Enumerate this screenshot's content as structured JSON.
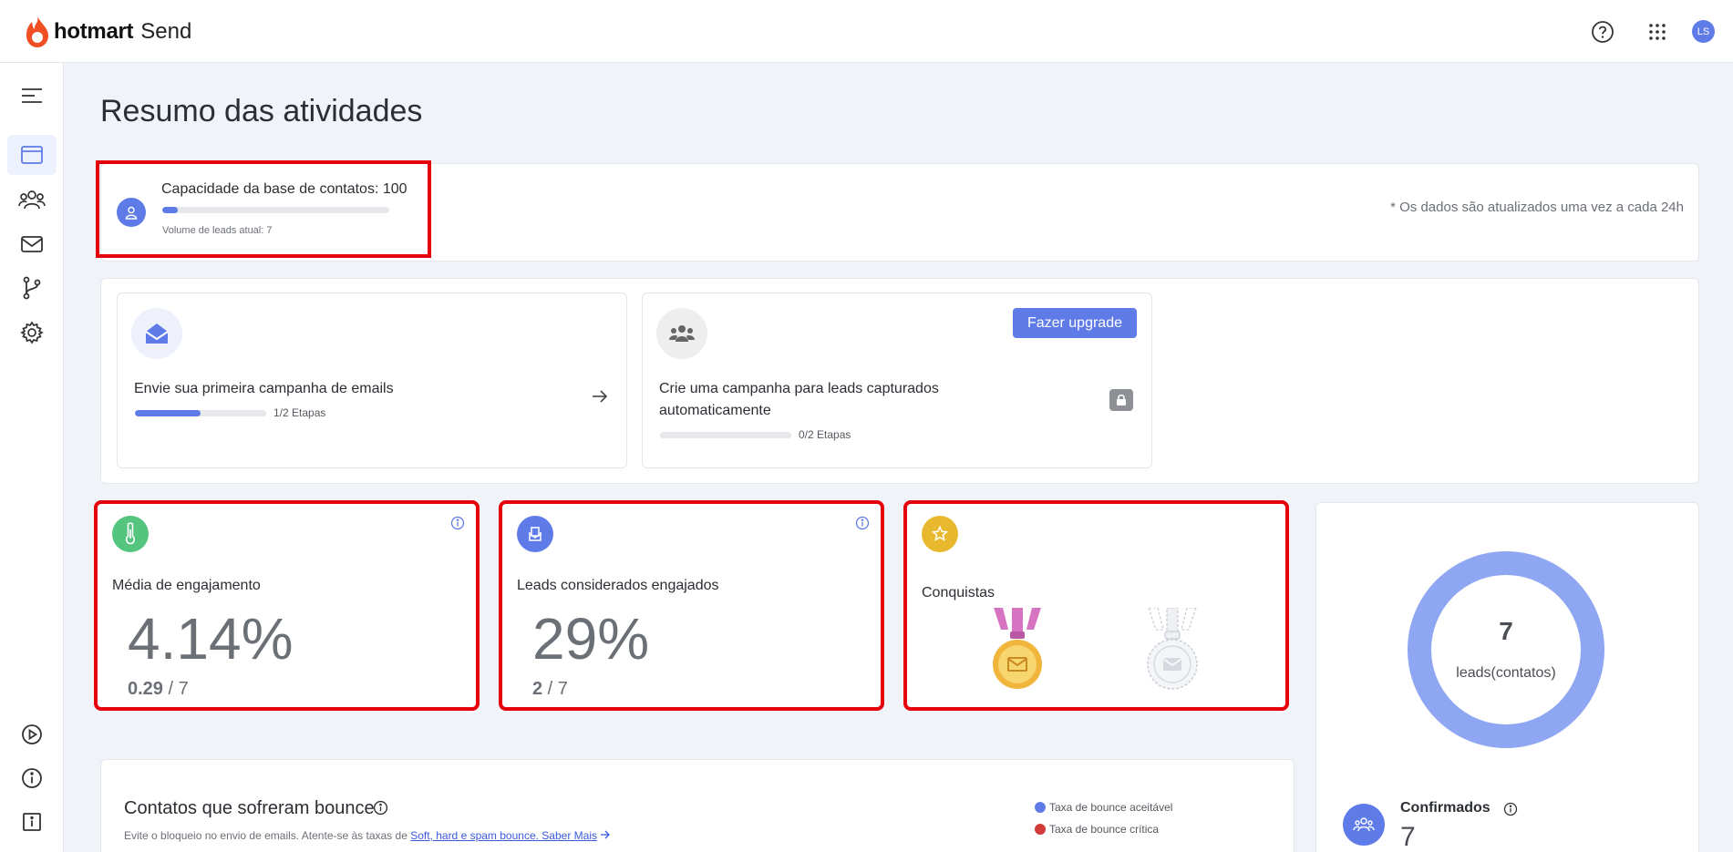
{
  "app": {
    "brand": "hotmart",
    "product": "Send",
    "user_initials": "LS"
  },
  "colors": {
    "accent": "#5f7be8",
    "highlight": "#e6000c",
    "engagement_green": "#55c47e",
    "achievement_yellow": "#e8b92e",
    "donut": "#8fa6f2",
    "critical": "#d33a3a"
  },
  "page": {
    "title": "Resumo das atividades"
  },
  "capacity": {
    "title": "Capacidade da base de contatos: 100",
    "progress_fraction": 0.07,
    "current_volume": "Volume de leads atual: 7",
    "note": "* Os dados são atualizados uma vez a cada 24h"
  },
  "steps": [
    {
      "title": "Envie sua primeira campanha de emails",
      "progress_fraction": 0.5,
      "count": "1/2 Etapas",
      "icon": "envelope-open-icon"
    },
    {
      "title": "Crie uma campanha para leads capturados automaticamente",
      "progress_fraction": 0,
      "count": "0/2 Etapas",
      "icon": "users-icon",
      "button": "Fazer upgrade"
    }
  ],
  "metrics": {
    "engagement": {
      "label": "Média de engajamento",
      "value": "4.14%",
      "numerator": "0.29",
      "denominator": " / 7"
    },
    "engaged_leads": {
      "label": "Leads considerados engajados",
      "value": "29%",
      "numerator": "2",
      "denominator": " / 7"
    },
    "achievements": {
      "label": "Conquistas"
    }
  },
  "leads": {
    "total": "7",
    "label": "leads(contatos)",
    "confirmed_label": "Confirmados",
    "confirmed_count": "7"
  },
  "bounce": {
    "title": "Contatos que sofreram bounce",
    "subtitle_prefix": "Evite o bloqueio no envio de emails. Atente-se às taxas de ",
    "link": "Soft, hard e spam bounce. Saber Mais",
    "legend": [
      {
        "label": "Taxa de bounce aceitável",
        "color": "#5f7be8"
      },
      {
        "label": "Taxa de bounce crítica",
        "color": "#d33a3a"
      }
    ]
  }
}
